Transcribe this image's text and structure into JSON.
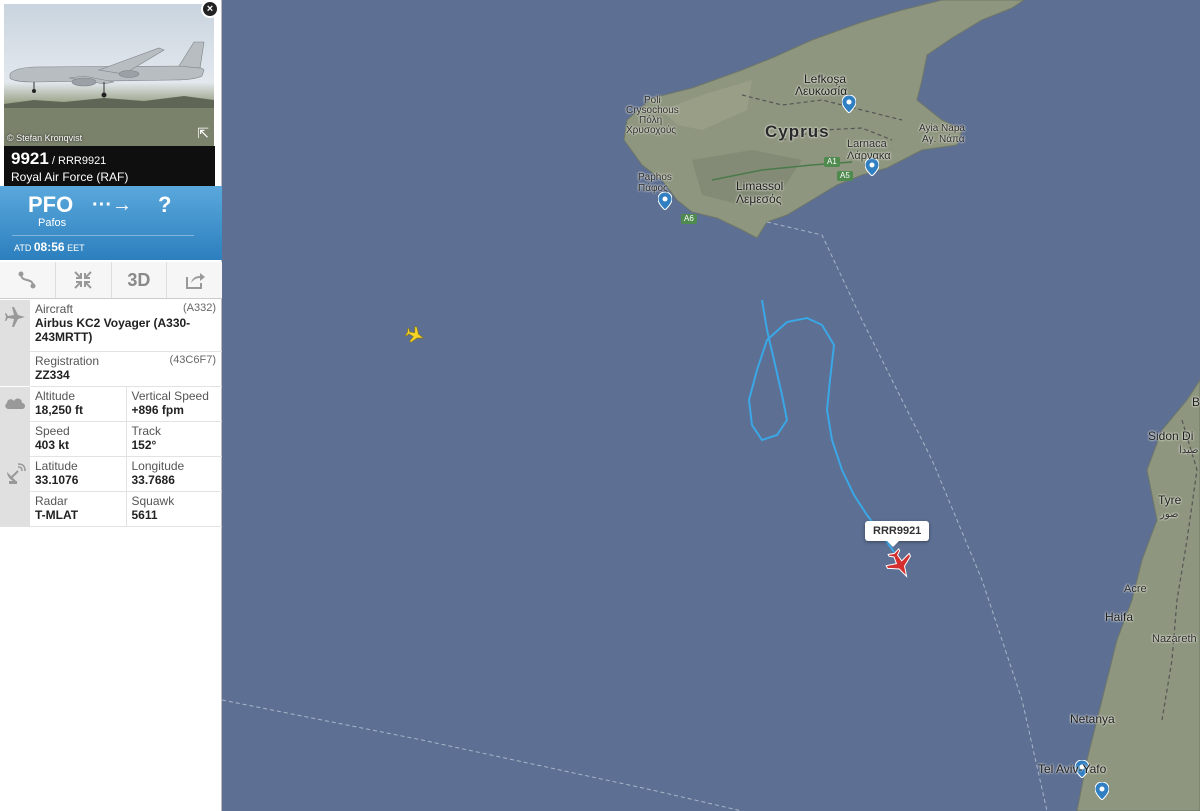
{
  "panel": {
    "close_label": "×",
    "photo_credit": "© Stefan Kronqvist",
    "flight_number": "9921",
    "callsign": " / RRR9921",
    "airline": "Royal Air Force (RAF)"
  },
  "route": {
    "origin_code": "PFO",
    "origin_name": "Pafos",
    "arrow": "···→",
    "destination_code": "?",
    "atd_label": "ATD",
    "atd_time": "08:56",
    "atd_tz": "EET"
  },
  "toolbar": {
    "view3d_label": "3D"
  },
  "details": {
    "aircraft_label": "Aircraft",
    "aircraft_code": "(A332)",
    "aircraft_value": "Airbus KC2 Voyager (A330-243MRTT)",
    "registration_label": "Registration",
    "registration_code": "(43C6F7)",
    "registration_value": "ZZ334",
    "altitude_label": "Altitude",
    "altitude_value": "18,250 ft",
    "vspeed_label": "Vertical Speed",
    "vspeed_value": "+896 fpm",
    "speed_label": "Speed",
    "speed_value": "403 kt",
    "track_label": "Track",
    "track_value": "152°",
    "latitude_label": "Latitude",
    "latitude_value": "33.1076",
    "longitude_label": "Longitude",
    "longitude_value": "33.7686",
    "radar_label": "Radar",
    "radar_value": "T-MLAT",
    "squawk_label": "Squawk",
    "squawk_value": "5611"
  },
  "map": {
    "flight_label": "RRR9921",
    "labels": {
      "lefkosa": "Lefkoşa",
      "lefkosia": "Λευκωσία",
      "cyprus": "Cyprus",
      "poli": "Poli",
      "crysochous": "Crysochous",
      "poli_gr": "Πόλη",
      "chrysochous_gr": "Χρυσοχούς",
      "paphos": "Paphos",
      "paphos_gr": "Πάφος",
      "limassol": "Limassol",
      "limassol_gr": "Λεμεσός",
      "larnaca": "Larnaca",
      "larnaca_gr": "Λάρνακα",
      "ayia_napa": "Ayia Napa",
      "ayia_napa_gr": "Αγ. Νάπα",
      "sidon": "Sidon Di",
      "sidon_ar": "صيدا",
      "tyre": "Tyre",
      "tyre_ar": "صور",
      "acre": "Acre",
      "haifa": "Haifa",
      "nazareth": "Nazareth",
      "netanya": "Netanya",
      "tel_aviv": "Tel Aviv-Yafo",
      "b": "B",
      "a1": "A1",
      "a5": "A5",
      "a6": "A6"
    },
    "colors": {
      "sea": "#5d6f92",
      "land": "#8f9885",
      "track": "#3aa7e6",
      "aircraft_selected": "#d32f2f",
      "aircraft_other": "#f5d327"
    }
  }
}
